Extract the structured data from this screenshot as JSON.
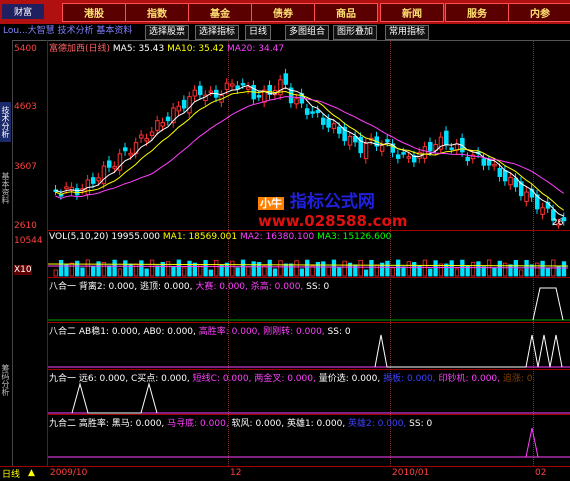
{
  "menu": {
    "logo": "财富",
    "items": [
      "港股",
      "指数",
      "基金",
      "债券",
      "商品",
      "新闻",
      "服务",
      "内参"
    ]
  },
  "toolbar": {
    "left_text": "Lou...大智慧 技术分析 基本资料",
    "buttons": [
      "选择股票",
      "选择指标",
      "日线",
      "多图组合",
      "图形叠加",
      "常用指标"
    ]
  },
  "sidebar": {
    "tabs": [
      "技术分析",
      "基本资料",
      "筹码分析"
    ]
  },
  "chart_header": {
    "title": "富德加西(日线)",
    "ma5": "MA5: 35.43",
    "ma10": "MA10: 35.42",
    "ma20": "MA20: 34.47"
  },
  "price_axis": [
    "5400",
    "4603",
    "3607",
    "2610"
  ],
  "price_low_marker": "26",
  "volume": {
    "header_name": "VOL(5,10,20)",
    "header_value": "19955.000",
    "ma1": "MA1: 18569.001",
    "ma2": "MA2: 16380.100",
    "ma3": "MA3: 15126.600",
    "axis_top": "10544",
    "axis_unit": "X10"
  },
  "indicators": [
    {
      "side": "八合一",
      "parts": [
        [
          "背离2: 0.000,",
          "#ffffff"
        ],
        [
          "逃顶: 0.000,",
          "#ffffff"
        ],
        [
          "大赛: 0.000,",
          "#ff40ff"
        ],
        [
          "杀高: 0.000,",
          "#ff40ff"
        ],
        [
          "SS: 0",
          "#ffffff"
        ]
      ]
    },
    {
      "side": "八合二",
      "parts": [
        [
          "AB稳1: 0.000,",
          "#ffffff"
        ],
        [
          "AB0: 0.000,",
          "#ffffff"
        ],
        [
          "高胜率: 0.000,",
          "#ff40ff"
        ],
        [
          "刚刚转: 0.000,",
          "#ff40ff"
        ],
        [
          "SS: 0",
          "#ffffff"
        ]
      ]
    },
    {
      "side": "九合一",
      "parts": [
        [
          "远6: 0.000,",
          "#ffffff"
        ],
        [
          "C买点: 0.000,",
          "#ffffff"
        ],
        [
          "短线C: 0.000,",
          "#ff40ff"
        ],
        [
          "两金叉: 0.000,",
          "#ff40ff"
        ],
        [
          "量价选: 0.000,",
          "#ffffff"
        ],
        [
          "揭板: 0.000,",
          "#4040ff"
        ],
        [
          "印钞机: 0.000,",
          "#ff40ff"
        ],
        [
          "追涨: 0",
          "#804000"
        ]
      ]
    },
    {
      "side": "九合二",
      "parts": [
        [
          "高胜率: 黑马: 0.000,",
          "#ffffff"
        ],
        [
          "马寻底: 0.000,",
          "#ff40ff"
        ],
        [
          "软风: 0.000,",
          "#ffffff"
        ],
        [
          "英雄1: 0.000,",
          "#ffffff"
        ],
        [
          "英雄2: 0.000,",
          "#4040ff"
        ],
        [
          "SS: 0",
          "#ffffff"
        ]
      ]
    }
  ],
  "x_axis": {
    "period_tab": "日线",
    "dates": [
      "2009/10",
      "12",
      "2010/01",
      "02"
    ]
  },
  "watermark": {
    "line1": "指标公式网",
    "line2": "www.028588.com",
    "badge": "小牛"
  },
  "colors": {
    "up": "#ff3030",
    "down": "#00e0ff",
    "ma5": "#ffffff",
    "ma10": "#ffff00",
    "ma20": "#ff40ff",
    "menu_bg": "#b01010"
  }
}
